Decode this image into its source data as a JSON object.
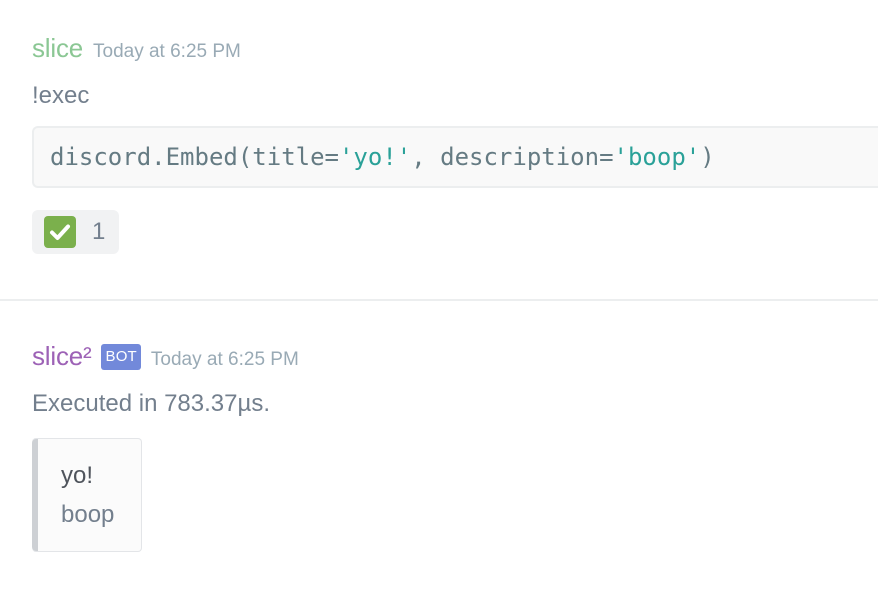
{
  "messages": [
    {
      "username": "slice",
      "timestamp": "Today at 6:25 PM",
      "content": "!exec",
      "code": {
        "prefix": "discord.Embed(title=",
        "str1": "'yo!'",
        "middle": ", description=",
        "str2": "'boop'",
        "suffix": ")"
      },
      "reaction": {
        "emoji": "white-check-mark",
        "count": "1"
      },
      "colors": {
        "username": "#8bc794"
      }
    },
    {
      "username": "slice²",
      "bot_tag": "BOT",
      "timestamp": "Today at 6:25 PM",
      "content": "Executed in 783.37µs.",
      "embed": {
        "title": "yo!",
        "description": "boop"
      },
      "colors": {
        "username": "#9d62b6",
        "bot_tag": "#7289da"
      }
    }
  ]
}
